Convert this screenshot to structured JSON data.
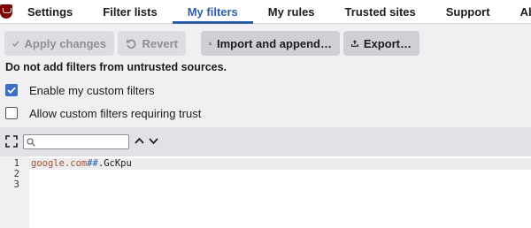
{
  "tabs": [
    {
      "label": "Settings"
    },
    {
      "label": "Filter lists"
    },
    {
      "label": "My filters",
      "active": true
    },
    {
      "label": "My rules"
    },
    {
      "label": "Trusted sites"
    },
    {
      "label": "Support"
    },
    {
      "label": "About"
    }
  ],
  "toolbar": {
    "apply_label": "Apply changes",
    "revert_label": "Revert",
    "import_label": "Import and append…",
    "export_label": "Export…"
  },
  "warning": "Do not add filters from untrusted sources.",
  "options": {
    "enable_custom": {
      "label": "Enable my custom filters",
      "checked": true
    },
    "allow_trust": {
      "label": "Allow custom filters requiring trust",
      "checked": false
    }
  },
  "search": {
    "value": "",
    "placeholder": ""
  },
  "editor": {
    "line_numbers": [
      "1",
      "2",
      "3"
    ],
    "line1": {
      "domain": "google.com",
      "separator": "##",
      "selector": ".GcKpu"
    }
  },
  "colors": {
    "accent": "#2a5fa8",
    "checkbox": "#3b6fc4",
    "logo": "#800000"
  }
}
